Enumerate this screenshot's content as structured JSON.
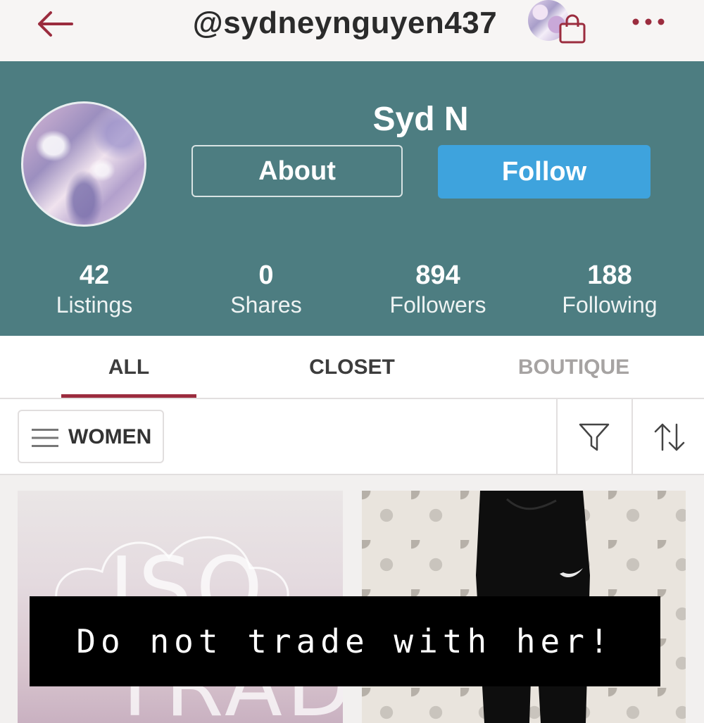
{
  "header": {
    "handle": "@sydneynguyen437",
    "back_icon": "arrow-left-icon",
    "cart_icon": "shopping-bag-icon",
    "more_icon": "more-dots-icon"
  },
  "profile": {
    "name": "Syd N",
    "about_label": "About",
    "follow_label": "Follow",
    "stats": [
      {
        "value": "42",
        "label": "Listings"
      },
      {
        "value": "0",
        "label": "Shares"
      },
      {
        "value": "894",
        "label": "Followers"
      },
      {
        "value": "188",
        "label": "Following"
      }
    ]
  },
  "tabs": [
    {
      "label": "ALL",
      "active": true
    },
    {
      "label": "CLOSET",
      "active": false
    },
    {
      "label": "BOUTIQUE",
      "active": false
    }
  ],
  "filters": {
    "department_label": "WOMEN",
    "filter_icon": "funnel-icon",
    "sort_icon": "sort-arrows-icon"
  },
  "listings": [
    {
      "image_text": "ISO TRADES"
    },
    {
      "image_text": ""
    }
  ],
  "overlay": {
    "text": "Do not trade with her!"
  },
  "colors": {
    "profile_bg": "#4d7d81",
    "follow_button": "#3ea3dd",
    "tab_underline": "#9b2c3e",
    "back_arrow": "#9b2c3e"
  }
}
